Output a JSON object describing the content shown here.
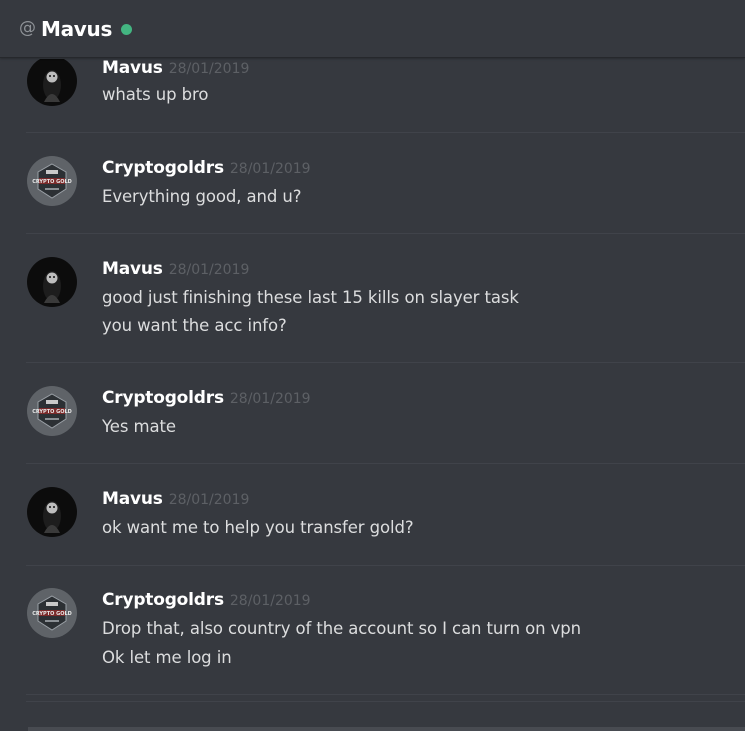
{
  "header": {
    "at_symbol": "@",
    "title": "Mavus",
    "status_color": "#43b581"
  },
  "messages": [
    {
      "author": "Mavus",
      "timestamp": "28/01/2019",
      "avatar_icon": "dark-hooded-figure-avatar",
      "lines": [
        "whats up bro"
      ]
    },
    {
      "author": "Cryptogoldrs",
      "timestamp": "28/01/2019",
      "avatar_icon": "crypto-gold-logo-avatar",
      "lines": [
        "Everything good, and u?"
      ]
    },
    {
      "author": "Mavus",
      "timestamp": "28/01/2019",
      "avatar_icon": "dark-hooded-figure-avatar",
      "lines": [
        "good just finishing these last 15 kills on slayer task",
        "you want the acc info?"
      ]
    },
    {
      "author": "Cryptogoldrs",
      "timestamp": "28/01/2019",
      "avatar_icon": "crypto-gold-logo-avatar",
      "lines": [
        "Yes mate"
      ]
    },
    {
      "author": "Mavus",
      "timestamp": "28/01/2019",
      "avatar_icon": "dark-hooded-figure-avatar",
      "lines": [
        "ok want me to help you transfer gold?"
      ]
    },
    {
      "author": "Cryptogoldrs",
      "timestamp": "28/01/2019",
      "avatar_icon": "crypto-gold-logo-avatar",
      "lines": [
        "Drop that, also country of the account so I can turn on vpn",
        "Ok let me log in"
      ]
    }
  ],
  "avatar_logo_text": "CRYPTO GOLD"
}
